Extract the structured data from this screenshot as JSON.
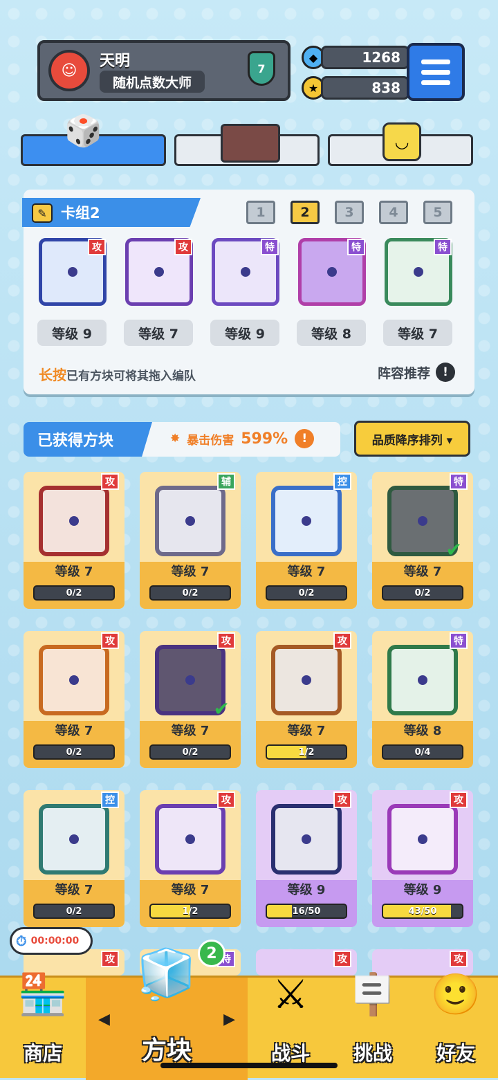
{
  "profile": {
    "name": "天明",
    "title": "随机点数大师",
    "rank": "7"
  },
  "currency": {
    "gems": "1268",
    "coins": "838"
  },
  "deck": {
    "title": "卡组2",
    "slots": [
      "1",
      "2",
      "3",
      "4",
      "5"
    ],
    "selected_slot": "2",
    "cards": [
      {
        "tag": "攻",
        "tag_color": "#e03a3a",
        "level": "等级 9",
        "frame": "#3045a8",
        "fill": "#dfe9fb"
      },
      {
        "tag": "攻",
        "tag_color": "#e03a3a",
        "level": "等级 7",
        "frame": "#6b3fb0",
        "fill": "#efe6fb"
      },
      {
        "tag": "特",
        "tag_color": "#8a4fd0",
        "level": "等级 9",
        "frame": "#6c4ac0",
        "fill": "#ece6fa"
      },
      {
        "tag": "特",
        "tag_color": "#8a4fd0",
        "level": "等级 8",
        "frame": "#b03fa8",
        "fill": "#c9a8ef"
      },
      {
        "tag": "特",
        "tag_color": "#8a4fd0",
        "level": "等级 7",
        "frame": "#3a8a5c",
        "fill": "#e6f3ea"
      }
    ],
    "hint_strong": "长按",
    "hint_text": "已有方块可将其拖入编队",
    "recommend": "阵容推荐"
  },
  "owned": {
    "label": "已获得方块",
    "crit_label": "暴击伤害",
    "crit_value": "599%",
    "sort": "品质降序排列 ▾"
  },
  "blocks": [
    {
      "tag": "攻",
      "tag_color": "#e03a3a",
      "level": "等级 7",
      "prog": "0/2",
      "pct": 0,
      "frame": "#a53030",
      "fill": "#f3e2dc",
      "purple": false,
      "check": false
    },
    {
      "tag": "辅",
      "tag_color": "#3aa55c",
      "level": "等级 7",
      "prog": "0/2",
      "pct": 0,
      "frame": "#6e6a8a",
      "fill": "#e6e6ee",
      "purple": false,
      "check": false
    },
    {
      "tag": "控",
      "tag_color": "#3b8fe8",
      "level": "等级 7",
      "prog": "0/2",
      "pct": 0,
      "frame": "#3a6fc8",
      "fill": "#e3eefb",
      "purple": false,
      "check": false
    },
    {
      "tag": "特",
      "tag_color": "#8a4fd0",
      "level": "等级 7",
      "prog": "0/2",
      "pct": 0,
      "frame": "#2f5a40",
      "fill": "#6a6f72",
      "purple": false,
      "check": true
    },
    {
      "tag": "攻",
      "tag_color": "#e03a3a",
      "level": "等级 7",
      "prog": "0/2",
      "pct": 0,
      "frame": "#c86a20",
      "fill": "#f8e4d4",
      "purple": false,
      "check": false
    },
    {
      "tag": "攻",
      "tag_color": "#e03a3a",
      "level": "等级 7",
      "prog": "0/2",
      "pct": 0,
      "frame": "#4a3380",
      "fill": "#5f5670",
      "purple": false,
      "check": true
    },
    {
      "tag": "攻",
      "tag_color": "#e03a3a",
      "level": "等级 7",
      "prog": "1/2",
      "pct": 50,
      "frame": "#a55a25",
      "fill": "#ece6e0",
      "purple": false,
      "check": false
    },
    {
      "tag": "特",
      "tag_color": "#8a4fd0",
      "level": "等级 8",
      "prog": "0/4",
      "pct": 0,
      "frame": "#2f7a4a",
      "fill": "#e4f2e8",
      "purple": false,
      "check": false
    },
    {
      "tag": "控",
      "tag_color": "#3b8fe8",
      "level": "等级 7",
      "prog": "0/2",
      "pct": 0,
      "frame": "#2f7a72",
      "fill": "#e4eef2",
      "purple": false,
      "check": false
    },
    {
      "tag": "攻",
      "tag_color": "#e03a3a",
      "level": "等级 7",
      "prog": "1/2",
      "pct": 50,
      "frame": "#6b3fb0",
      "fill": "#eee6f8",
      "purple": false,
      "check": false
    },
    {
      "tag": "攻",
      "tag_color": "#e03a3a",
      "level": "等级 9",
      "prog": "16/50",
      "pct": 32,
      "frame": "#2a2f70",
      "fill": "#e6e6f0",
      "purple": true,
      "check": false
    },
    {
      "tag": "攻",
      "tag_color": "#e03a3a",
      "level": "等级 9",
      "prog": "43/50",
      "pct": 86,
      "frame": "#9a3ab8",
      "fill": "#f4ecfa",
      "purple": true,
      "check": false
    }
  ],
  "partial_row_tags": [
    "攻",
    "待",
    "攻",
    "攻"
  ],
  "timer": "00:00:00",
  "nav": {
    "shop": "商店",
    "blocks": "方块",
    "battle": "战斗",
    "challenge": "挑战",
    "friends": "好友",
    "blocks_badge": "2"
  }
}
